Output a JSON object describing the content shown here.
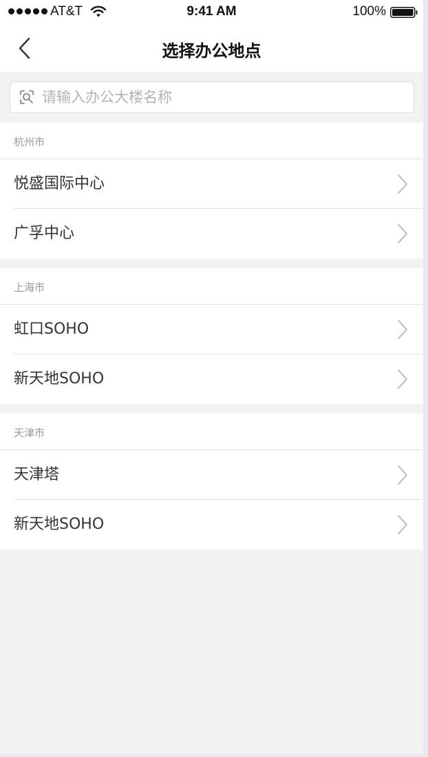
{
  "status_bar": {
    "carrier": "AT&T",
    "time": "9:41 AM",
    "battery": "100%"
  },
  "nav": {
    "title": "选择办公地点"
  },
  "search": {
    "placeholder": "请输入办公大楼名称",
    "value": ""
  },
  "groups": [
    {
      "city": "杭州市",
      "items": [
        {
          "label": "悦盛国际中心"
        },
        {
          "label": "广孚中心"
        }
      ]
    },
    {
      "city": "上海市",
      "items": [
        {
          "label": "虹口SOHO"
        },
        {
          "label": "新天地SOHO"
        }
      ]
    },
    {
      "city": "天津市",
      "items": [
        {
          "label": "天津塔"
        },
        {
          "label": "新天地SOHO"
        }
      ]
    }
  ],
  "icons": {
    "back": "chevron-left-icon",
    "search": "scan-icon",
    "row": "chevron-right-icon",
    "wifi": "wifi-icon",
    "battery": "battery-icon"
  },
  "colors": {
    "background": "#f2f2f2",
    "surface": "#ffffff",
    "text": "#333333",
    "muted": "#999999",
    "divider": "#e3e3e3"
  }
}
